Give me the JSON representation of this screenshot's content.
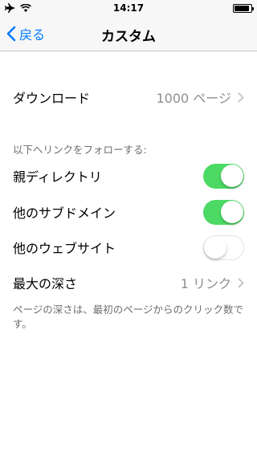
{
  "status_bar": {
    "time": "14:17"
  },
  "nav": {
    "back_label": "戻る",
    "title": "カスタム"
  },
  "download": {
    "label": "ダウンロード",
    "value": "1000 ページ"
  },
  "follow_section": {
    "header": "以下へリンクをフォローする:"
  },
  "toggles": [
    {
      "label": "親ディレクトリ",
      "on": true
    },
    {
      "label": "他のサブドメイン",
      "on": true
    },
    {
      "label": "他のウェブサイト",
      "on": false
    }
  ],
  "max_depth": {
    "label": "最大の深さ",
    "value": "1 リンク"
  },
  "footnote": "ページの深さは、最初のページからのクリック数です。",
  "colors": {
    "accent": "#007aff",
    "toggle_on": "#4cd964",
    "secondary_text": "#8e8e93"
  }
}
